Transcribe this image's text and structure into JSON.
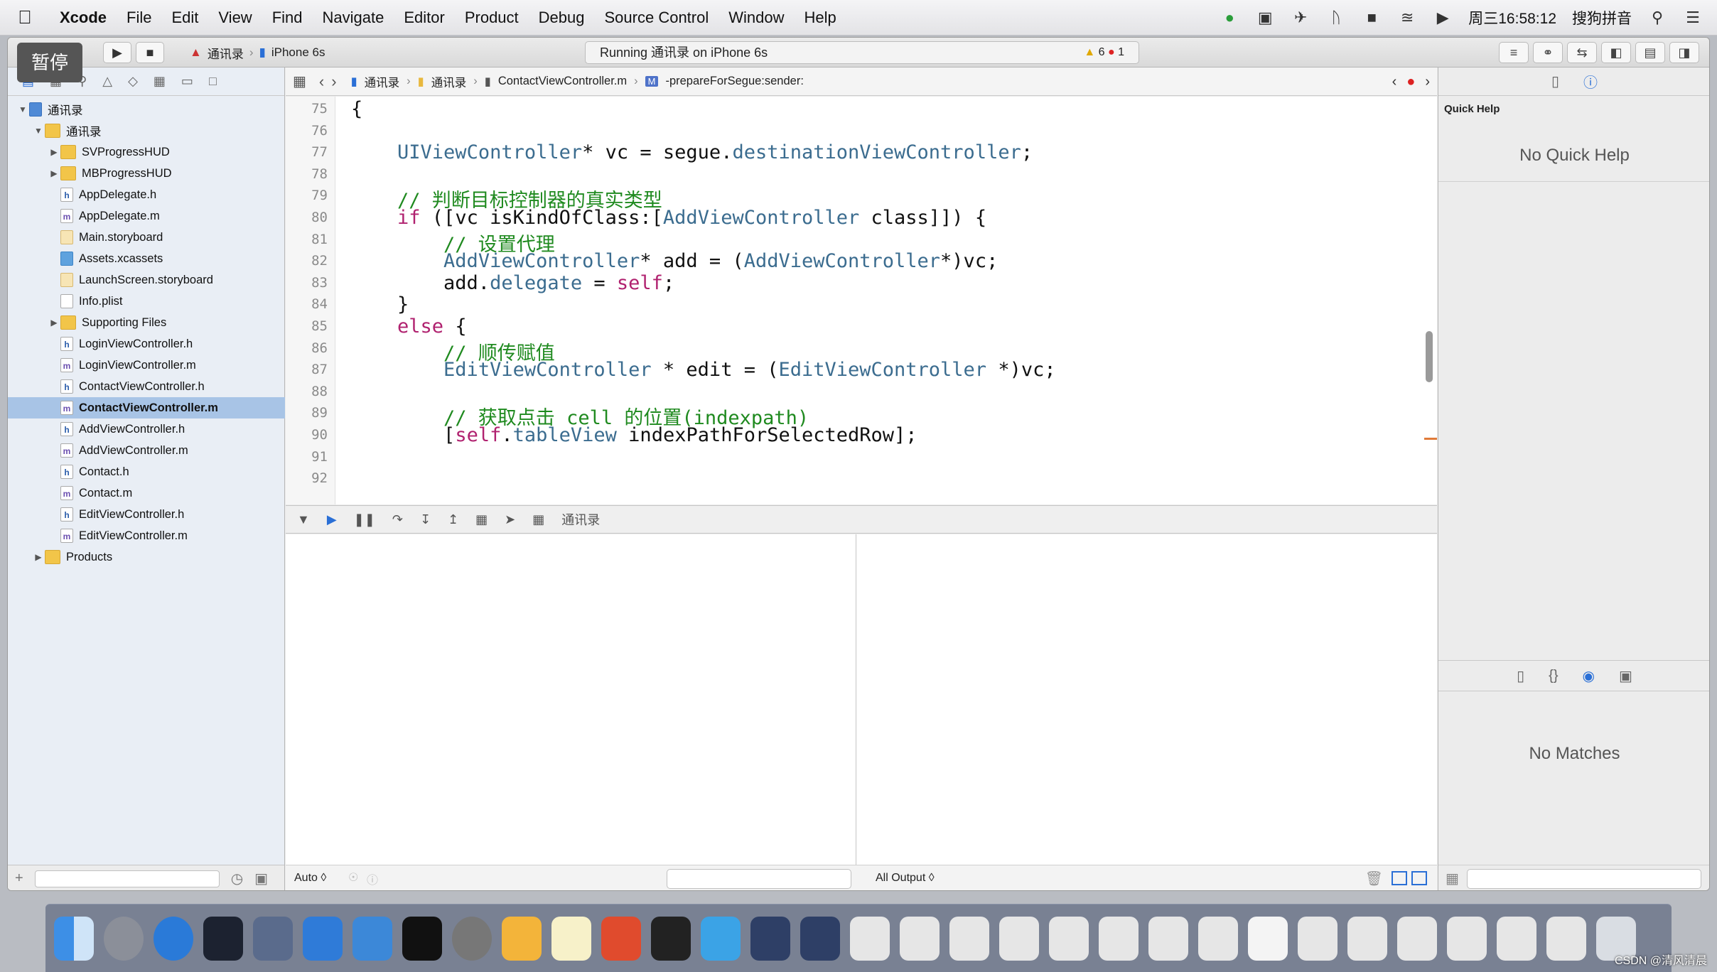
{
  "menubar": {
    "items": [
      "Xcode",
      "File",
      "Edit",
      "View",
      "Find",
      "Navigate",
      "Editor",
      "Product",
      "Debug",
      "Source Control",
      "Window",
      "Help"
    ],
    "clock": "周三16:58:12",
    "ime": "搜狗拼音"
  },
  "toolbar": {
    "pause_overlay": "暂停",
    "scheme": "通讯录",
    "device": "iPhone 6s",
    "status": "Running 通讯录 on iPhone 6s",
    "warnings": "6",
    "errors": "1"
  },
  "navigator": {
    "items": [
      {
        "label": "通讯录",
        "icon": "project-icon",
        "indent": 0,
        "open": true
      },
      {
        "label": "通讯录",
        "icon": "folder-icon",
        "indent": 1,
        "open": true
      },
      {
        "label": "SVProgressHUD",
        "icon": "folder-icon",
        "indent": 2,
        "closed": true
      },
      {
        "label": "MBProgressHUD",
        "icon": "folder-icon",
        "indent": 2,
        "closed": true
      },
      {
        "label": "AppDelegate.h",
        "icon": "h-file-icon",
        "indent": 2
      },
      {
        "label": "AppDelegate.m",
        "icon": "m-file-icon",
        "indent": 2
      },
      {
        "label": "Main.storyboard",
        "icon": "storyboard-icon",
        "indent": 2
      },
      {
        "label": "Assets.xcassets",
        "icon": "assets-icon",
        "indent": 2
      },
      {
        "label": "LaunchScreen.storyboard",
        "icon": "storyboard-icon",
        "indent": 2
      },
      {
        "label": "Info.plist",
        "icon": "plist-icon",
        "indent": 2
      },
      {
        "label": "Supporting Files",
        "icon": "folder-icon",
        "indent": 2,
        "closed": true
      },
      {
        "label": "LoginViewController.h",
        "icon": "h-file-icon",
        "indent": 2
      },
      {
        "label": "LoginViewController.m",
        "icon": "m-file-icon",
        "indent": 2
      },
      {
        "label": "ContactViewController.h",
        "icon": "h-file-icon",
        "indent": 2
      },
      {
        "label": "ContactViewController.m",
        "icon": "m-file-icon",
        "indent": 2,
        "selected": true
      },
      {
        "label": "AddViewController.h",
        "icon": "h-file-icon",
        "indent": 2
      },
      {
        "label": "AddViewController.m",
        "icon": "m-file-icon",
        "indent": 2
      },
      {
        "label": "Contact.h",
        "icon": "h-file-icon",
        "indent": 2
      },
      {
        "label": "Contact.m",
        "icon": "m-file-icon",
        "indent": 2
      },
      {
        "label": "EditViewController.h",
        "icon": "h-file-icon",
        "indent": 2
      },
      {
        "label": "EditViewController.m",
        "icon": "m-file-icon",
        "indent": 2
      },
      {
        "label": "Products",
        "icon": "folder-icon",
        "indent": 1,
        "closed": true
      }
    ]
  },
  "jumpbar": {
    "crumbs": [
      "通讯录",
      "通讯录",
      "ContactViewController.m",
      "-prepareForSegue:sender:"
    ]
  },
  "editor": {
    "lines": [
      {
        "n": "75",
        "code": [
          [
            "{",
            "fn"
          ]
        ]
      },
      {
        "n": "76",
        "code": []
      },
      {
        "n": "77",
        "code": [
          [
            "    ",
            ""
          ],
          [
            "UIViewController",
            "ty"
          ],
          [
            "* vc = segue.",
            ""
          ],
          [
            "destinationViewController",
            "pr"
          ],
          [
            ";",
            ""
          ]
        ]
      },
      {
        "n": "78",
        "code": []
      },
      {
        "n": "79",
        "code": [
          [
            "    // 判断目标控制器的真实类型",
            "cm"
          ]
        ]
      },
      {
        "n": "80",
        "code": [
          [
            "    ",
            ""
          ],
          [
            "if",
            "kw"
          ],
          [
            " ([vc isKindOfClass:[",
            ""
          ],
          [
            "AddViewController",
            "ty"
          ],
          [
            " class]]) {",
            ""
          ]
        ]
      },
      {
        "n": "81",
        "code": [
          [
            "        // 设置代理",
            "cm"
          ]
        ]
      },
      {
        "n": "82",
        "code": [
          [
            "        ",
            ""
          ],
          [
            "AddViewController",
            "ty"
          ],
          [
            "* add = (",
            ""
          ],
          [
            "AddViewController",
            "ty"
          ],
          [
            "*)vc;",
            ""
          ]
        ]
      },
      {
        "n": "83",
        "code": [
          [
            "        add.",
            ""
          ],
          [
            "delegate",
            "pr"
          ],
          [
            " = ",
            ""
          ],
          [
            "self",
            "kw"
          ],
          [
            ";",
            ""
          ]
        ]
      },
      {
        "n": "84",
        "code": [
          [
            "    }",
            ""
          ]
        ]
      },
      {
        "n": "85",
        "code": [
          [
            "    ",
            ""
          ],
          [
            "else",
            "kw"
          ],
          [
            " {",
            ""
          ]
        ]
      },
      {
        "n": "86",
        "code": [
          [
            "        // 顺传赋值",
            "cm"
          ]
        ]
      },
      {
        "n": "87",
        "code": [
          [
            "        ",
            ""
          ],
          [
            "EditViewController",
            "ty"
          ],
          [
            " * edit = (",
            ""
          ],
          [
            "EditViewController",
            "ty"
          ],
          [
            " *)vc;",
            ""
          ]
        ]
      },
      {
        "n": "88",
        "code": []
      },
      {
        "n": "89",
        "code": [
          [
            "        // 获取点击 cell 的位置(indexpath)",
            "cm"
          ]
        ]
      },
      {
        "n": "90",
        "code": [
          [
            "        [",
            ""
          ],
          [
            "self",
            "kw"
          ],
          [
            ".",
            ""
          ],
          [
            "tableView",
            "pr"
          ],
          [
            " indexPathForSelectedRow];",
            ""
          ]
        ]
      },
      {
        "n": "91",
        "code": []
      },
      {
        "n": "92",
        "code": []
      }
    ]
  },
  "debugbar": {
    "target": "通讯录"
  },
  "console": {
    "auto": "Auto ◊",
    "output": "All Output ◊"
  },
  "inspector": {
    "quick_help_title": "Quick Help",
    "no_quick_help": "No Quick Help",
    "no_matches": "No Matches"
  },
  "watermark": "CSDN @清风清晨"
}
